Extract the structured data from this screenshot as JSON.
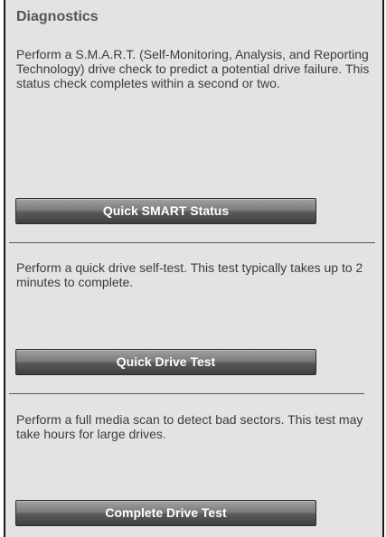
{
  "panel": {
    "title": "Diagnostics",
    "sections": [
      {
        "description": "Perform a S.M.A.R.T. (Self-Monitoring, Analysis, and Reporting Technology) drive check to predict a potential drive failure. This status check completes within a second or two.",
        "button_label": "Quick SMART Status"
      },
      {
        "description": "Perform a quick drive self-test. This test typically takes up to 2 minutes to complete.",
        "button_label": "Quick Drive Test"
      },
      {
        "description": "Perform a full media scan to detect bad sectors. This test may take hours for large drives.",
        "button_label": "Complete Drive Test"
      }
    ]
  }
}
